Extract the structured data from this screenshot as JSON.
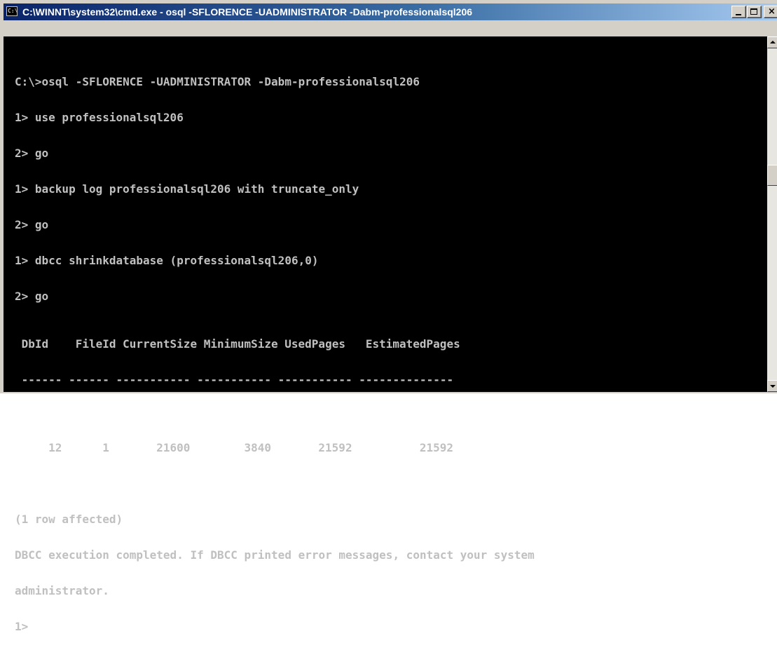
{
  "window": {
    "title": "C:\\WINNT\\system32\\cmd.exe - osql -SFLORENCE -UADMINISTRATOR -Dabm-professionalsql206",
    "icon": "console-icon",
    "icon_label": "C:\\"
  },
  "console": {
    "lines": [
      "C:\\>osql -SFLORENCE -UADMINISTRATOR -Dabm-professionalsql206",
      "1> use professionalsql206",
      "2> go",
      "1> backup log professionalsql206 with truncate_only",
      "2> go",
      "1> dbcc shrinkdatabase (professionalsql206,0)",
      "2> go"
    ],
    "table": {
      "headers": [
        "DbId",
        "FileId",
        "CurrentSize",
        "MinimumSize",
        "UsedPages",
        "EstimatedPages"
      ],
      "separator": " ------ ------ ----------- ----------- ----------- --------------",
      "rows": [
        [
          "12",
          "1",
          "21600",
          "3840",
          "21592",
          "21592"
        ]
      ]
    },
    "footer_lines": [
      "(1 row affected)",
      "DBCC execution completed. If DBCC printed error messages, contact your system",
      "administrator.",
      "1>"
    ]
  },
  "colors": {
    "console_bg": "#000000",
    "console_fg": "#c0c0c0",
    "titlebar_start": "#0a246a",
    "titlebar_end": "#a6caf0"
  }
}
